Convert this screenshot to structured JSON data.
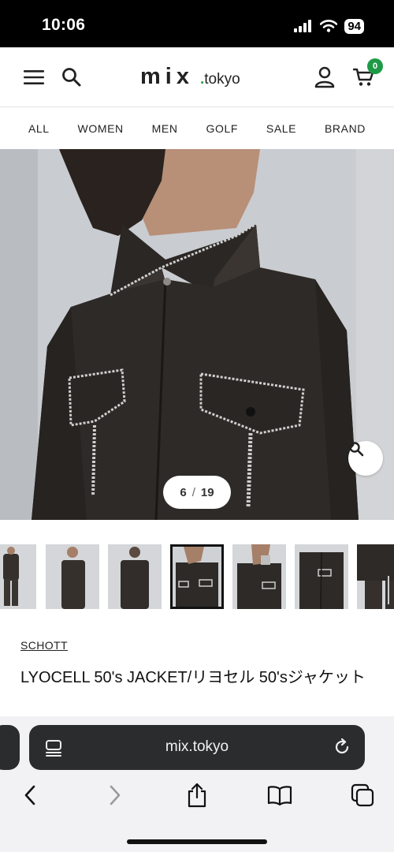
{
  "status_bar": {
    "time": "10:06",
    "battery": "94"
  },
  "header": {
    "logo_main": "mix",
    "logo_dot": ".",
    "logo_sub": "tokyo",
    "cart_count": "0"
  },
  "nav": {
    "items": [
      "ALL",
      "WOMEN",
      "MEN",
      "GOLF",
      "SALE",
      "BRAND"
    ]
  },
  "gallery": {
    "current": "6",
    "separator": "/",
    "total": "19"
  },
  "product": {
    "brand": "SCHOTT",
    "title": "LYOCELL 50's JACKET/リヨセル 50'sジャケット"
  },
  "browser": {
    "url": "mix.tokyo"
  },
  "colors": {
    "accent_green": "#1e9a47",
    "jacket": "#2e2a27"
  }
}
